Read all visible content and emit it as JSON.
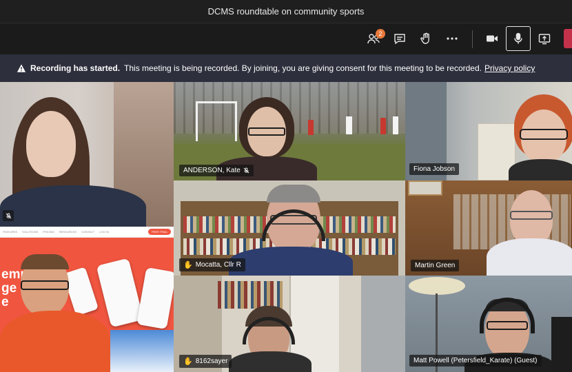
{
  "window": {
    "title": "DCMS roundtable on community sports"
  },
  "toolbar": {
    "participants_badge": "2",
    "buttons": [
      {
        "name": "participants-button",
        "icon": "people-icon"
      },
      {
        "name": "chat-button",
        "icon": "chat-icon"
      },
      {
        "name": "raise-hand-button",
        "icon": "hand-icon"
      },
      {
        "name": "more-options-button",
        "icon": "more-icon"
      },
      {
        "name": "camera-button",
        "icon": "video-camera-icon"
      },
      {
        "name": "microphone-button",
        "icon": "microphone-icon"
      },
      {
        "name": "share-screen-button",
        "icon": "share-icon"
      },
      {
        "name": "leave-button",
        "icon": "leave-icon"
      }
    ],
    "leave_color": "#c4314b"
  },
  "banner": {
    "title": "Recording has started.",
    "message": "This meeting is being recorded. By joining, you are giving consent for this meeting to be recorded.",
    "link": "Privacy policy"
  },
  "site": {
    "nav": [
      "FEATURES",
      "SOLUTIONS",
      "PRICING",
      "RESOURCES",
      "CONTACT",
      "LOG IN"
    ],
    "cta": "FREE TRIAL",
    "headline_lines": [
      "emp",
      "ge e",
      "e"
    ]
  },
  "participants": [
    {
      "name": "",
      "icon": "mic-off-icon"
    },
    {
      "name": "ANDERSON, Kate",
      "icon": "mic-off-icon"
    },
    {
      "name": "Fiona Jobson"
    },
    {
      "name": "Mocatta, Cllr R",
      "icon": "hand-icon"
    },
    {
      "name": "Martin Green"
    },
    {
      "name": "",
      "icon": "presenter"
    },
    {
      "name": "8162sayer",
      "icon": "hand-icon"
    },
    {
      "name": "Matt Powell (Petersfield_Karate) (Guest)"
    }
  ]
}
